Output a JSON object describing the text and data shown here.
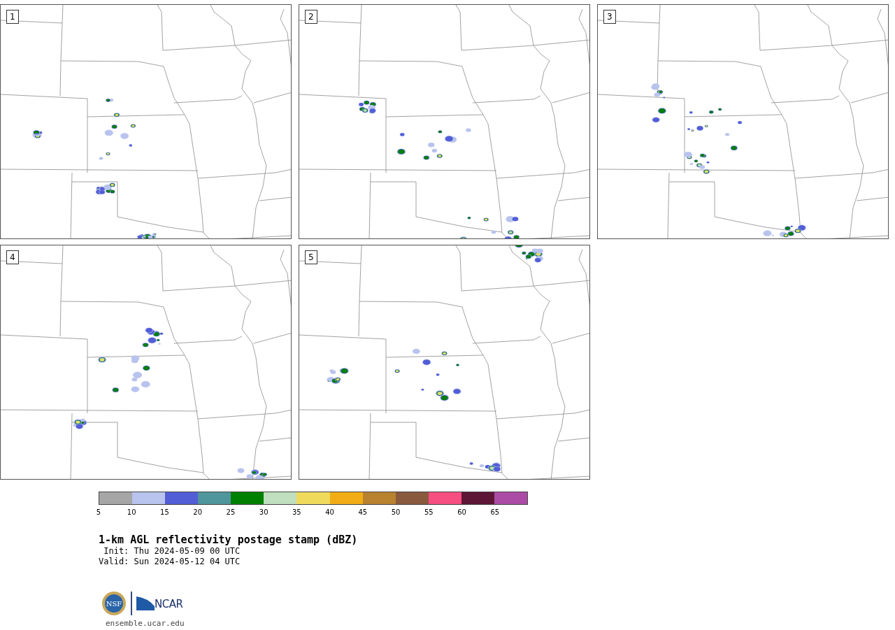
{
  "panels": [
    {
      "label": "1"
    },
    {
      "label": "2"
    },
    {
      "label": "3"
    },
    {
      "label": "4"
    },
    {
      "label": "5"
    }
  ],
  "colorbar": {
    "bins": [
      {
        "color": "#a6a6a6"
      },
      {
        "color": "#b8c3ee"
      },
      {
        "color": "#525ed6"
      },
      {
        "color": "#4f969c"
      },
      {
        "color": "#008000"
      },
      {
        "color": "#bfdfbf"
      },
      {
        "color": "#f0da5c"
      },
      {
        "color": "#f0ad15"
      },
      {
        "color": "#b8822e"
      },
      {
        "color": "#8a5a3e"
      },
      {
        "color": "#f54e80"
      },
      {
        "color": "#5e1636"
      },
      {
        "color": "#ac4ba6"
      }
    ],
    "ticks": [
      "5",
      "10",
      "15",
      "20",
      "25",
      "30",
      "35",
      "40",
      "45",
      "50",
      "55",
      "60",
      "65"
    ]
  },
  "title": "1-km AGL reflectivity postage stamp (dBZ)",
  "init": " Init: Thu 2024-05-09 00 UTC",
  "valid": "Valid: Sun 2024-05-12 04 UTC",
  "logos": {
    "nsf": "NSF",
    "ncar": "NCAR"
  },
  "url": "ensemble.ucar.edu"
}
